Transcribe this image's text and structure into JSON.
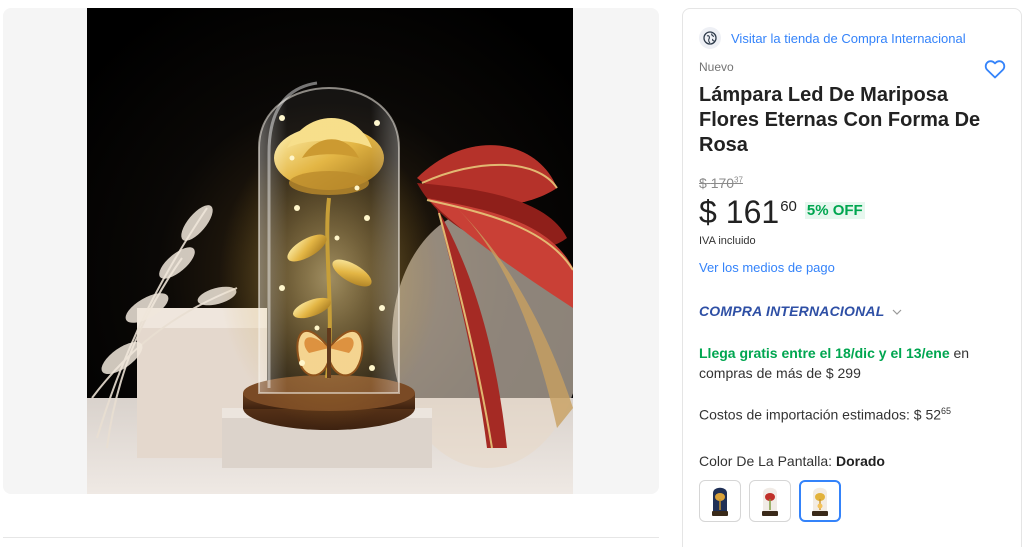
{
  "store": {
    "link_label": "Visitar la tienda de Compra Internacional",
    "logo_icon": "globe-icon"
  },
  "product": {
    "condition": "Nuevo",
    "title": "Lámpara Led De Mariposa Flores Eternas Con Forma De Rosa",
    "favorite_icon": "heart-outline-icon"
  },
  "price": {
    "original_currency": "$",
    "original_integer": "170",
    "original_cents": "37",
    "currency": "$",
    "integer": "161",
    "cents": "60",
    "discount": "5% OFF",
    "tax_note": "IVA incluido",
    "payment_link": "Ver los medios de pago"
  },
  "international": {
    "label": "COMPRA INTERNACIONAL",
    "chevron_icon": "chevron-down-icon"
  },
  "shipping": {
    "text_1": "Llega gratis entre el ",
    "date_1": "18/dic",
    "text_2": " y el ",
    "date_2": "13/ene",
    "text_3": " en compras de más de $ 299"
  },
  "import_costs": {
    "label": "Costos de importación estimados: ",
    "currency": "$",
    "integer": "52",
    "cents": "65"
  },
  "color": {
    "label": "Color De La Pantalla: ",
    "selected": "Dorado",
    "options": [
      "blue-lamp-swatch",
      "red-lamp-swatch",
      "gold-lamp-swatch"
    ],
    "selected_index": 2
  },
  "colors": {
    "link": "#3483fa",
    "success": "#00a650",
    "international": "#2e4fa5",
    "selected_border": "#3483fa"
  }
}
